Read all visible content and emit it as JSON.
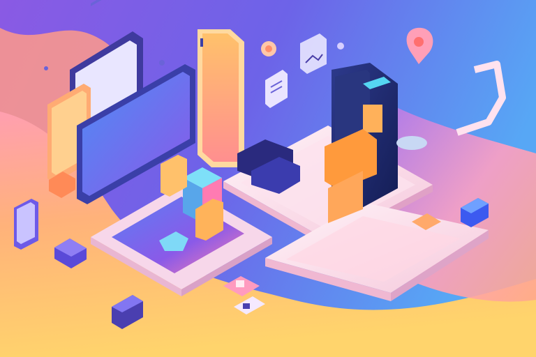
{
  "scene": {
    "style": "isometric illustration",
    "palette": {
      "sky_top_left": "#7f5be6",
      "sky_top_right": "#5aa4f4",
      "wave_orange": "#ff9e6b",
      "wave_yellow": "#ffd36a",
      "wave_pink": "#ff8fb0",
      "tile_white": "#fbe9f3",
      "accent_blue": "#4a5cf0",
      "accent_navy": "#1f2a6b",
      "accent_orange": "#ff9a3c",
      "accent_purple": "#8a58e8",
      "accent_cyan": "#55d6f2"
    },
    "icons": [
      "document-icon",
      "image-icon",
      "location-pin-icon",
      "chat-bubble-icon",
      "smartphone-icon",
      "monitor-icon",
      "robot-device-icon",
      "cube-icon"
    ]
  }
}
